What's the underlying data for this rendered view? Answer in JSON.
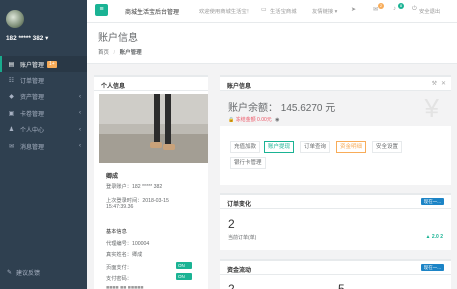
{
  "sidebar": {
    "user": "182 ***** 382",
    "items": [
      {
        "label": "账户管理",
        "badge": "1+",
        "icon": "▤",
        "active": true
      },
      {
        "label": "订单管理",
        "icon": "☷"
      },
      {
        "label": "资产管理",
        "icon": "◆",
        "arrow": "‹"
      },
      {
        "label": "卡卷管理",
        "icon": "▣",
        "arrow": "‹"
      },
      {
        "label": "个人中心",
        "icon": "♟",
        "arrow": "‹"
      },
      {
        "label": "消息管理",
        "icon": "✉",
        "arrow": "‹"
      }
    ],
    "bottom": "建议反馈"
  },
  "topbar": {
    "title": "商城生活宝后台管理",
    "welcome": "欢迎使用商城生活宝！",
    "link1": "生活宝商城",
    "link2": "友情链接 ▾",
    "badge1": "2",
    "badge2": "8",
    "logout": "安全退出"
  },
  "page": {
    "title": "账户信息",
    "crumb_home": "首页",
    "crumb_sep": "/",
    "crumb_current": "账户管理"
  },
  "personal": {
    "title": "个人信息",
    "name": "卿成",
    "account": "登录账户：182 ***** 382",
    "last_login_label": "上次登录时间：2018-03-15",
    "last_login_time": "15:47:39.36",
    "basic_info": "基本信息",
    "hidden_no": "代理编号：100004",
    "real_name": "真实姓名：卿成",
    "pay_pwd": "页面支付：",
    "pay_pwd2": "支付密码：",
    "on1": "ON",
    "on2": "ON",
    "extra": "■■■■ ■■ ■■■■■"
  },
  "account": {
    "title": "账户信息",
    "balance_label": "账户余额：",
    "balance": "145.6270",
    "currency": "元",
    "frozen": "冻结金额",
    "frozen_val": "0.00元",
    "yuan_icon": "¥",
    "tabs": [
      "充值加款",
      "账户提现",
      "订单查询",
      "资金明细",
      "安全设置",
      "银行卡管理"
    ]
  },
  "order_change": {
    "title": "订单变化",
    "label": "现在一...",
    "value": "2",
    "sub": "当前订单(单)",
    "trend": "▲ 2.0 2"
  },
  "fund_flow": {
    "title": "资金流动",
    "label": "现在一...",
    "value_a": "2",
    "value_b": "5"
  }
}
